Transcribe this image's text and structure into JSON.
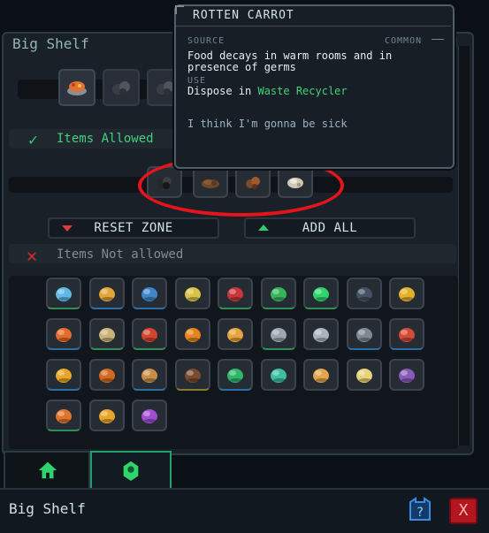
{
  "panel": {
    "title": "Big Shelf",
    "close_glyph": "d"
  },
  "tooltip": {
    "title": "ROTTEN CARROT",
    "source_label": "SOURCE",
    "rarity": "COMMON",
    "description": "Food decays in warm rooms and in presence of germs",
    "use_label": "USE",
    "use_prefix": "Dispose in ",
    "use_target": "Waste Recycler",
    "flavor": "I think I'm gonna be sick"
  },
  "tabs": [
    {
      "icon": "food-tray-icon"
    },
    {
      "icon": "rocks-icon"
    },
    {
      "icon": "rocks-icon"
    }
  ],
  "allowed": {
    "label": "Items Allowed",
    "items": [
      {
        "icon": "charcoal-icon"
      },
      {
        "icon": "rotten-carrot-icon"
      },
      {
        "icon": "rotten-food-icon"
      },
      {
        "icon": "bone-icon"
      }
    ]
  },
  "buttons": {
    "reset_zone": "RESET ZONE",
    "add_all": "ADD ALL"
  },
  "not_allowed": {
    "label": "Items Not allowed",
    "items": [
      {
        "icon": "blue-metal-icon",
        "color": "#5fb8e6",
        "accent": "green"
      },
      {
        "icon": "orange-canister-icon",
        "color": "#e0a63a",
        "accent": "blue"
      },
      {
        "icon": "blue-canister-icon",
        "color": "#3f86c8",
        "accent": "blue"
      },
      {
        "icon": "wheat-icon",
        "color": "#d9c24a",
        "accent": "none"
      },
      {
        "icon": "berries-icon",
        "color": "#c9353a",
        "accent": "green"
      },
      {
        "icon": "green-canister-icon",
        "color": "#38b45b",
        "accent": "green"
      },
      {
        "icon": "green-crystal-icon",
        "color": "#2fd46c",
        "accent": "green"
      },
      {
        "icon": "dark-ore-icon",
        "color": "#445263",
        "accent": "none"
      },
      {
        "icon": "gold-ore-icon",
        "color": "#e3b128",
        "accent": "none"
      },
      {
        "icon": "meat-slab-icon",
        "color": "#e56a2b",
        "accent": "blue"
      },
      {
        "icon": "tan-scrap-icon",
        "color": "#c9b47a",
        "accent": "green"
      },
      {
        "icon": "red-parts-icon",
        "color": "#d2442c",
        "accent": "green"
      },
      {
        "icon": "amber-crystal-icon",
        "color": "#e8841d",
        "accent": "none"
      },
      {
        "icon": "pizza-slice-icon",
        "color": "#e9a33b",
        "accent": "none"
      },
      {
        "icon": "grey-canister-icon",
        "color": "#9aa6b0",
        "accent": "green"
      },
      {
        "icon": "steel-chunks-icon",
        "color": "#a9b4be",
        "accent": "none"
      },
      {
        "icon": "gray-block-icon",
        "color": "#7d8a96",
        "accent": "blue"
      },
      {
        "icon": "red-machine-icon",
        "color": "#d34a35",
        "accent": "blue"
      },
      {
        "icon": "gold-bars-icon",
        "color": "#e8a72a",
        "accent": "blue"
      },
      {
        "icon": "roast-meat-icon",
        "color": "#d26a22",
        "accent": "none"
      },
      {
        "icon": "cooking-pot-icon",
        "color": "#c98f4a",
        "accent": "blue"
      },
      {
        "icon": "coffee-cup-icon",
        "color": "#7a4a2d",
        "accent": "gold"
      },
      {
        "icon": "medkit-icon",
        "color": "#2fb86a",
        "accent": "blue"
      },
      {
        "icon": "potion-icon",
        "color": "#3dbfa2",
        "accent": "none"
      },
      {
        "icon": "bread-icon",
        "color": "#e3a64a",
        "accent": "none"
      },
      {
        "icon": "egg-bowl-icon",
        "color": "#e8d27a",
        "accent": "none"
      },
      {
        "icon": "purple-ore-icon",
        "color": "#8a5ab8",
        "accent": "none"
      },
      {
        "icon": "food-tray-icon",
        "color": "#e0742f",
        "accent": "green"
      },
      {
        "icon": "waffle-icon",
        "color": "#e8a72a",
        "accent": "none"
      },
      {
        "icon": "purple-drink-icon",
        "color": "#a04fd0",
        "accent": "none"
      }
    ]
  },
  "footer": {
    "title": "Big Shelf",
    "help_glyph": "?",
    "close_glyph": "X"
  },
  "bottom_tabs": [
    {
      "icon": "home-icon"
    },
    {
      "icon": "crew-icon"
    }
  ],
  "colors": {
    "accent_green": "#36c76b",
    "accent_red": "#d72a2a",
    "highlight_red": "#e4141b"
  }
}
